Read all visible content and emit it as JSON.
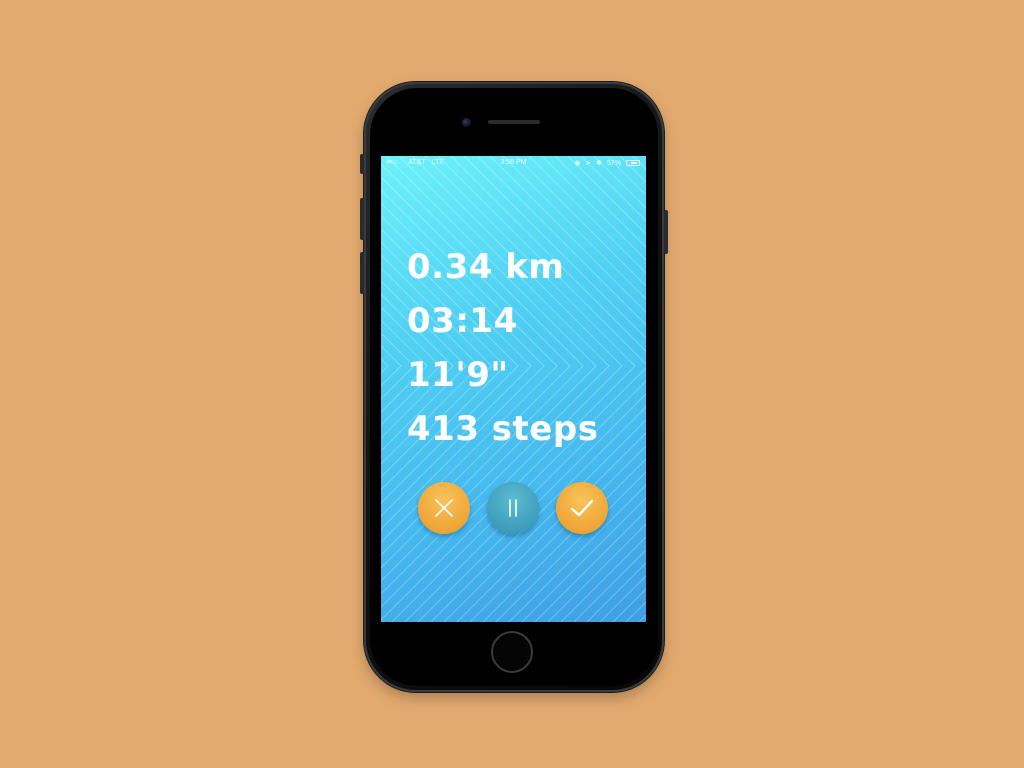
{
  "status_bar": {
    "signal": "•••○○",
    "carrier": "AT&T",
    "network": "LTE",
    "time": "3:58 PM",
    "battery_percent": "57%",
    "battery_level": 0.57
  },
  "workout": {
    "distance": "0.34 km",
    "duration": "03:14",
    "pace": "11'9\"",
    "steps": "413 steps"
  },
  "controls": {
    "cancel_icon": "close-icon",
    "pause_icon": "pause-icon",
    "done_icon": "checkmark-icon"
  },
  "colors": {
    "background": "#e3aa6f",
    "screen_top": "#6df2fa",
    "screen_bottom": "#3e9fe4",
    "accent_orange": "#f1a93a",
    "accent_teal": "#3f9fbd",
    "text": "#ffffff"
  }
}
